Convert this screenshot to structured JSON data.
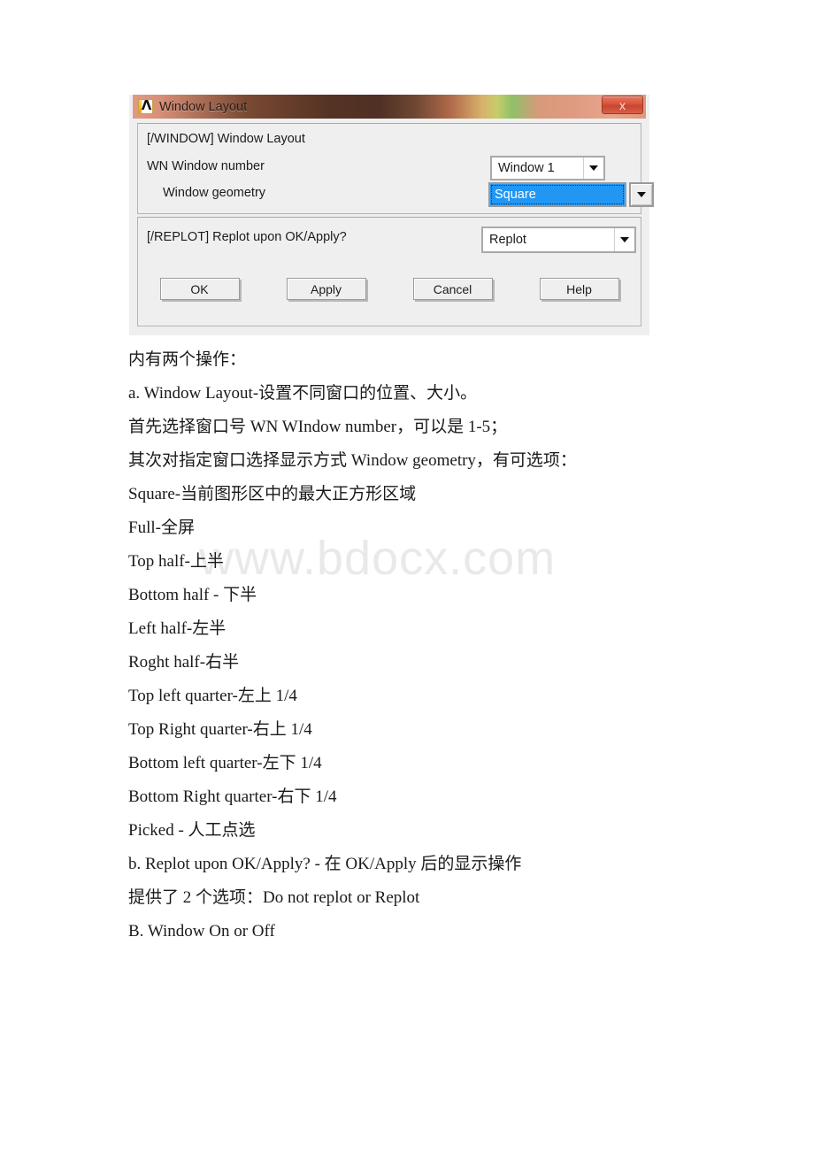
{
  "watermark": "www.bdocx.com",
  "dialog": {
    "title": "Window Layout",
    "icon": "ansys-lambda-icon",
    "close_label": "x",
    "section_window": {
      "header": "[/WINDOW]  Window Layout",
      "rows": [
        {
          "label": "WN  Window number",
          "value": "Window 1",
          "state": "normal"
        },
        {
          "label": "Window geometry",
          "value": "Square",
          "state": "focused"
        }
      ]
    },
    "section_replot": {
      "label": "[/REPLOT]  Replot upon OK/Apply?",
      "value": "Replot"
    },
    "buttons": [
      {
        "label": "OK",
        "name": "ok-button"
      },
      {
        "label": "Apply",
        "name": "apply-button"
      },
      {
        "label": "Cancel",
        "name": "cancel-button"
      },
      {
        "label": "Help",
        "name": "help-button"
      }
    ]
  },
  "document_lines": [
    "内有两个操作：",
    "a. Window Layout-设置不同窗口的位置、大小。",
    "首先选择窗口号 WN WIndow number，可以是 1-5；",
    "其次对指定窗口选择显示方式 Window geometry，有可选项：",
    "Square-当前图形区中的最大正方形区域",
    "Full-全屏",
    "Top half-上半",
    "Bottom half - 下半",
    "Left half-左半",
    "Roght half-右半",
    "Top left quarter-左上 1/4",
    "Top Right quarter-右上 1/4",
    "Bottom left quarter-左下 1/4",
    "Bottom Right quarter-右下 1/4",
    "Picked - 人工点选",
    "b. Replot upon OK/Apply? - 在 OK/Apply 后的显示操作",
    "提供了 2 个选项：Do not replot or Replot",
    "B. Window On or Off"
  ],
  "colors": {
    "focus_highlight": "#2196f3",
    "dialog_face": "#efefef",
    "watermark": "#e9e9e9",
    "close_button": "#d9543c"
  }
}
